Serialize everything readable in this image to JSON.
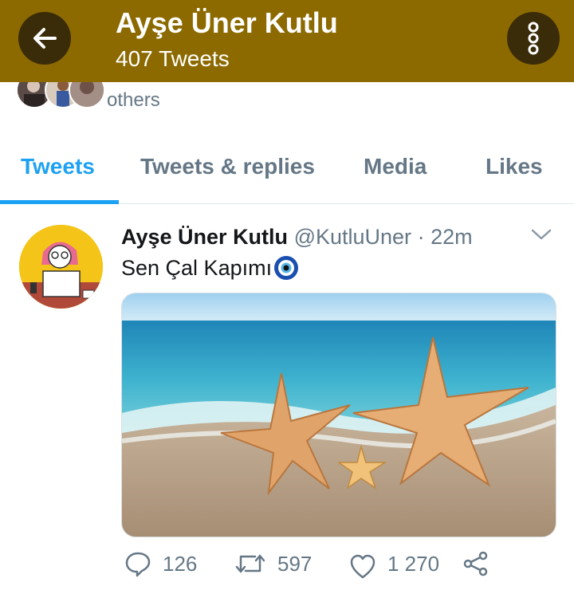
{
  "header": {
    "name": "Ayşe Üner Kutlu",
    "tweet_count": "407 Tweets",
    "back_icon": "arrow-left-icon",
    "menu_icon": "vertical-dots-icon",
    "bg_color": "#8c6a00",
    "button_color": "#3a2c08"
  },
  "followers": {
    "text": "others"
  },
  "tabs": [
    {
      "label": "Tweets",
      "active": true
    },
    {
      "label": "Tweets & replies",
      "active": false
    },
    {
      "label": "Media",
      "active": false
    },
    {
      "label": "Likes",
      "active": false
    }
  ],
  "accent_color": "#1da1f2",
  "tweet": {
    "author_name": "Ayşe Üner Kutlu",
    "handle": "@KutluUner",
    "separator": "·",
    "time": "22m",
    "text": "Sen Çal Kapımı",
    "emoji_icon": "nazar-amulet-icon",
    "media_description_icon": "beach-starfish-image",
    "stats": {
      "replies": "126",
      "retweets": "597",
      "likes": "1 270"
    }
  }
}
